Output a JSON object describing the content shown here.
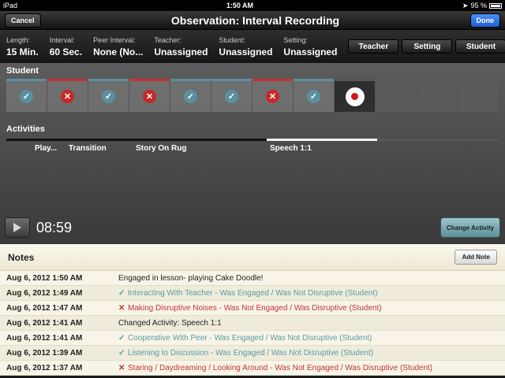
{
  "status_bar": {
    "device": "iPad",
    "time": "1:50 AM",
    "battery": "95 %"
  },
  "nav": {
    "cancel_label": "Cancel",
    "title": "Observation: Interval Recording",
    "done_label": "Done"
  },
  "info": {
    "fields": [
      {
        "label": "Length:",
        "value": "15 Min."
      },
      {
        "label": "Interval:",
        "value": "60 Sec."
      },
      {
        "label": "Peer Interval:",
        "value": "None (No..."
      },
      {
        "label": "Teacher:",
        "value": "Unassigned"
      },
      {
        "label": "Student:",
        "value": "Unassigned"
      },
      {
        "label": "Setting:",
        "value": "Unassigned"
      }
    ],
    "buttons": [
      "Teacher",
      "Setting",
      "Student"
    ]
  },
  "student_label": "Student",
  "intervals": [
    "ok",
    "bad",
    "ok",
    "bad",
    "ok",
    "ok",
    "bad",
    "ok",
    "current",
    "empty",
    "empty",
    "empty"
  ],
  "activities_label": "Activities",
  "activities": [
    {
      "name": "Play...",
      "active": false
    },
    {
      "name": "Transition",
      "active": false
    },
    {
      "name": "Story On Rug",
      "active": false
    },
    {
      "name": "Speech 1:1",
      "active": true
    }
  ],
  "timer": "08:59",
  "change_activity_label": "Change Activity",
  "notes_title": "Notes",
  "add_note_label": "Add Note",
  "notes": [
    {
      "time": "Aug 6, 2012 1:50 AM",
      "type": "plain",
      "text": "Engaged in lesson- playing Cake Doodle!"
    },
    {
      "time": "Aug 6, 2012 1:49 AM",
      "type": "ok",
      "text": "Interacting With Teacher - Was Engaged / Was Not Disruptive (Student)"
    },
    {
      "time": "Aug 6, 2012 1:47 AM",
      "type": "bad",
      "text": "Making Disruptive Noises - Was Not Engaged / Was Disruptive (Student)"
    },
    {
      "time": "Aug 6, 2012 1:41 AM",
      "type": "plain",
      "text": "Changed Activity: Speech 1:1"
    },
    {
      "time": "Aug 6, 2012 1:41 AM",
      "type": "ok",
      "text": "Cooperative With Peer - Was Engaged / Was Not Disruptive (Student)"
    },
    {
      "time": "Aug 6, 2012 1:39 AM",
      "type": "ok",
      "text": "Listening to Discussion - Was Engaged / Was Not Disruptive (Student)"
    },
    {
      "time": "Aug 6, 2012 1:37 AM",
      "type": "bad",
      "text": "Staring / Daydreaming / Looking Around - Was Not Engaged / Was Disruptive (Student)"
    }
  ],
  "colors": {
    "ok": "#5a8fa0",
    "bad": "#c82828",
    "done": "#1c5ed8"
  }
}
